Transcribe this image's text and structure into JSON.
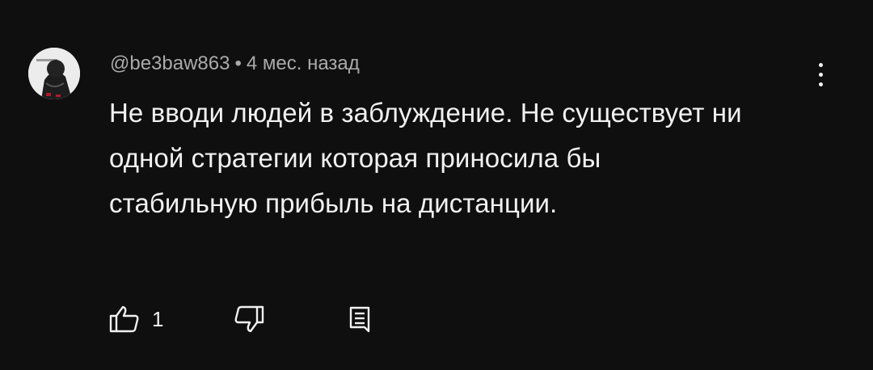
{
  "comment": {
    "author": "@be3baw863",
    "separator": "•",
    "time_ago": "4 мес. назад",
    "text": "Не вводи людей в заблуждение. Не существует ни одной стратегии которая приносила бы стабильную прибыль на дистанции.",
    "likes": "1"
  },
  "icons": {
    "avatar": "avatar-image",
    "more": "more-vert-icon",
    "like": "thumb-up-icon",
    "dislike": "thumb-down-icon",
    "reply": "reply-comment-icon"
  },
  "colors": {
    "background": "#0f0f0f",
    "text_primary": "#f1f1f1",
    "text_secondary": "#aaaaaa"
  }
}
